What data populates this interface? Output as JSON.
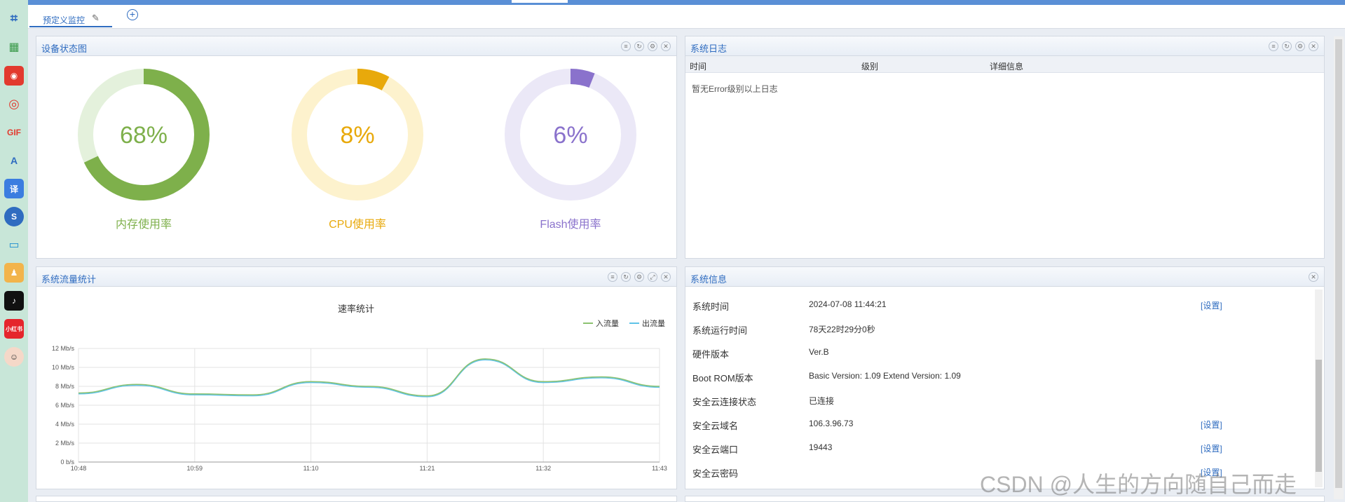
{
  "tabs": {
    "active": "预定义监控",
    "add_symbol": "+"
  },
  "panels": {
    "device_status": {
      "title": "设备状态图"
    },
    "system_log": {
      "title": "系统日志"
    },
    "traffic": {
      "title": "系统流量统计"
    },
    "sysinfo": {
      "title": "系统信息"
    }
  },
  "gauges": [
    {
      "value": 68,
      "text": "68%",
      "label": "内存使用率",
      "color": "#7eb04b",
      "track": "#e4f1dc"
    },
    {
      "value": 8,
      "text": "8%",
      "label": "CPU使用率",
      "color": "#e8a90b",
      "track": "#fdf2cd"
    },
    {
      "value": 6,
      "text": "6%",
      "label": "Flash使用率",
      "color": "#8a72cc",
      "track": "#ebe8f7"
    }
  ],
  "log": {
    "columns": [
      "时间",
      "级别",
      "详细信息"
    ],
    "empty_text": "暂无Error级别以上日志"
  },
  "sysinfo": {
    "rows": [
      {
        "label": "系统时间",
        "value": "2024-07-08 11:44:21",
        "link": "[设置]"
      },
      {
        "label": "系统运行时间",
        "value": "78天22时29分0秒",
        "link": ""
      },
      {
        "label": "硬件版本",
        "value": "Ver.B",
        "link": ""
      },
      {
        "label": "Boot ROM版本",
        "value": "Basic Version:  1.09   Extend Version:  1.09",
        "link": ""
      },
      {
        "label": "安全云连接状态",
        "value": "已连接",
        "link": ""
      },
      {
        "label": "安全云域名",
        "value": "106.3.96.73",
        "link": "[设置]"
      },
      {
        "label": "安全云端口",
        "value": "19443",
        "link": "[设置]"
      },
      {
        "label": "安全云密码",
        "value": "",
        "link": "[设置]"
      }
    ]
  },
  "chart_data": {
    "type": "line",
    "title": "速率统计",
    "xlabel": "",
    "ylabel": "",
    "x_ticks": [
      "10:48",
      "10:59",
      "11:10",
      "11:21",
      "11:32",
      "11:43"
    ],
    "y_ticks": [
      "0 b/s",
      "2 Mb/s",
      "4 Mb/s",
      "6 Mb/s",
      "8 Mb/s",
      "10 Mb/s",
      "12 Mb/s"
    ],
    "ylim": [
      0,
      12
    ],
    "grid": true,
    "legend_position": "top-right",
    "x": [
      "10:48",
      "10:53",
      "10:59",
      "11:04",
      "11:10",
      "11:15",
      "11:21",
      "11:26",
      "11:32",
      "11:37",
      "11:43"
    ],
    "series": [
      {
        "name": "入流量",
        "color": "#8cc270",
        "values": [
          7.3,
          8.2,
          7.2,
          7.1,
          8.5,
          8.0,
          7.0,
          10.9,
          8.5,
          9.0,
          8.0
        ]
      },
      {
        "name": "出流量",
        "color": "#5fc3e8",
        "values": [
          7.2,
          8.1,
          7.1,
          7.0,
          8.4,
          7.9,
          6.9,
          10.8,
          8.4,
          8.9,
          7.9
        ]
      }
    ]
  },
  "watermark": "CSDN @人生的方向随自己而走",
  "colors": {
    "accent": "#2f6cc0",
    "topbar": "#5a8fd6",
    "sidebar": "#c8e6d8"
  }
}
